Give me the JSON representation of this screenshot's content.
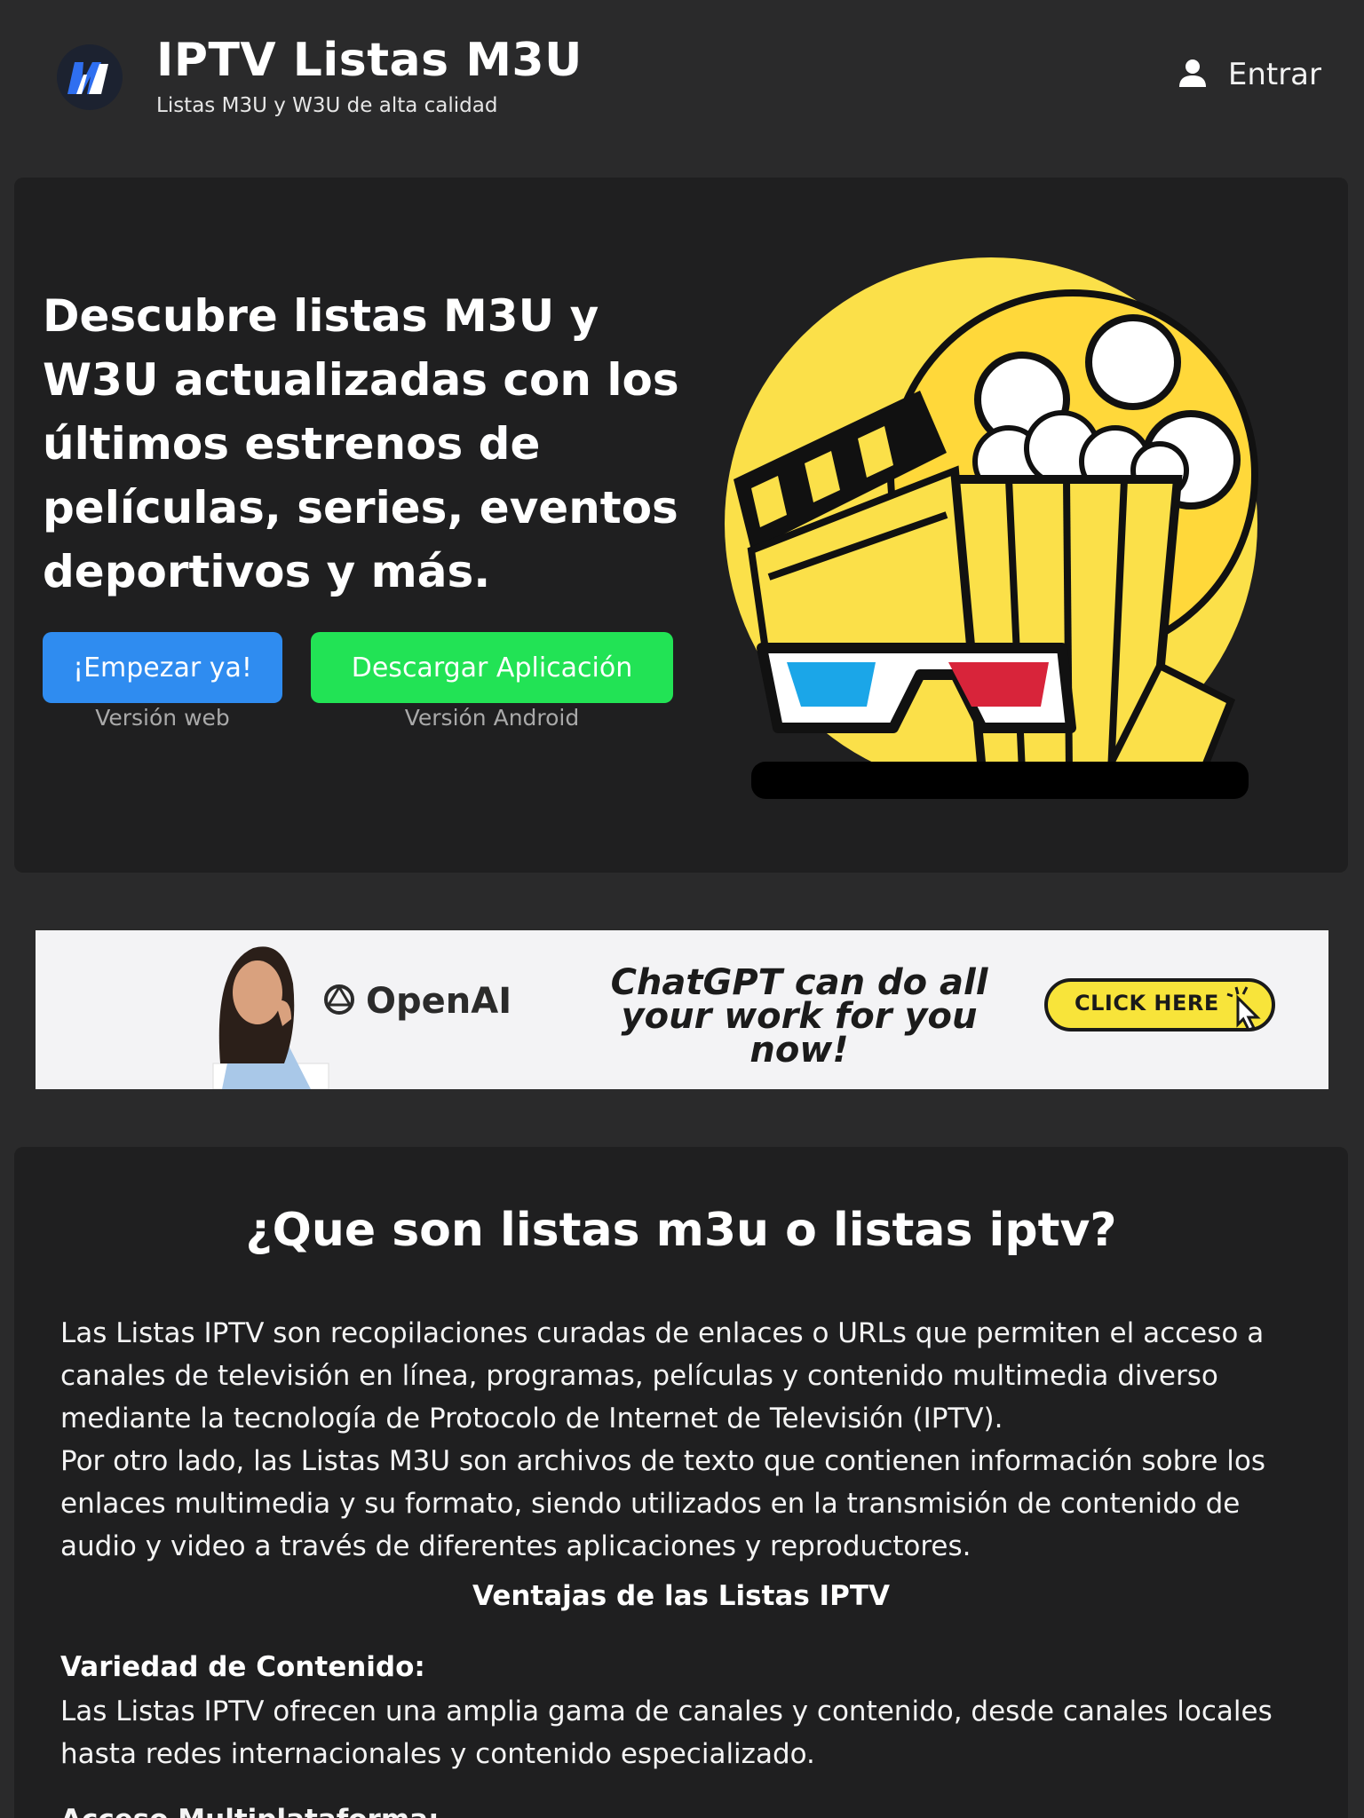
{
  "header": {
    "title": "IPTV Listas M3U",
    "subtitle": "Listas M3U y W3U de alta calidad",
    "login_label": "Entrar"
  },
  "hero": {
    "title": "Descubre listas M3U y W3U actualizadas con los últimos estrenos de películas, series, eventos deportivos y más.",
    "start_button": "¡Empezar ya!",
    "start_caption": "Versión web",
    "download_button": "Descargar Aplicación",
    "download_caption": "Versión Android"
  },
  "ad": {
    "brand": "OpenAI",
    "headline": "ChatGPT can do all your work for you now!",
    "cta": "CLICK HERE"
  },
  "info": {
    "title": "¿Que son listas m3u o listas iptv?",
    "paragraph1": "Las Listas IPTV son recopilaciones curadas de enlaces o URLs que permiten el acceso a canales de televisión en línea, programas, películas y contenido multimedia diverso mediante la tecnología de Protocolo de Internet de Televisión (IPTV).",
    "paragraph2": "Por otro lado, las Listas M3U son archivos de texto que contienen información sobre los enlaces multimedia y su formato, siendo utilizados en la transmisión de contenido de audio y video a través de diferentes aplicaciones y reproductores.",
    "advantages_title": "Ventajas de las Listas IPTV",
    "item1_title": "Variedad de Contenido:",
    "item1_text": "Las Listas IPTV ofrecen una amplia gama de canales y contenido, desde canales locales hasta redes internacionales y contenido especializado.",
    "item2_title_partial": "Acceso Multiplataforma:"
  },
  "colors": {
    "background": "#2a2a2b",
    "card": "#1f1f20",
    "start_button": "#2f8cf0",
    "download_button": "#22e355",
    "illustration_yellow": "#fbe049"
  },
  "icons": {
    "logo": "m3u-logo-icon",
    "login": "user-icon",
    "ad_brand": "openai-logo-icon",
    "ad_cta": "cursor-click-icon"
  }
}
